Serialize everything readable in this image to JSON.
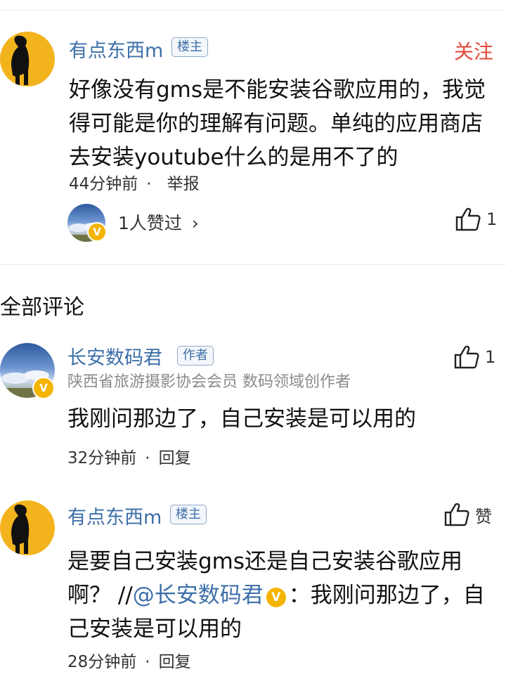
{
  "post": {
    "author": "有点东西m",
    "author_tag": "楼主",
    "follow_label": "关注",
    "body": "好像没有gms是不能安装谷歌应用的，我觉得可能是你的理解有问题。单纯的应用商店去安装youtube什么的是用不了的",
    "time": "44分钟前",
    "separator": "·",
    "report_label": "举报",
    "likers_text": "1人赞过",
    "likers_chevron": "›",
    "like_count": "1"
  },
  "section": {
    "title": "全部评论"
  },
  "comments": [
    {
      "author": "长安数码君",
      "author_tag": "作者",
      "subtitle": "陕西省旅游摄影协会会员 数码领域创作者",
      "body": "我刚问那边了，自己安装是可以用的",
      "time": "32分钟前",
      "separator": "·",
      "reply_label": "回复",
      "like_count": "1"
    },
    {
      "author": "有点东西m",
      "author_tag": "楼主",
      "body_prefix": "是要自己安装gms还是自己安装谷歌应用啊？ //",
      "mention": "@长安数码君",
      "mention_badge": "V",
      "body_suffix": "：我刚问那边了，自己安装是可以用的",
      "time": "28分钟前",
      "separator": "·",
      "reply_label": "回复",
      "like_label": "赞"
    }
  ],
  "colors": {
    "accent_blue": "#3d6fa8",
    "follow_red": "#e24b3b",
    "verified_gold": "#f4b400"
  },
  "icons": {
    "verified": "V",
    "like": "thumbs-up-icon"
  }
}
